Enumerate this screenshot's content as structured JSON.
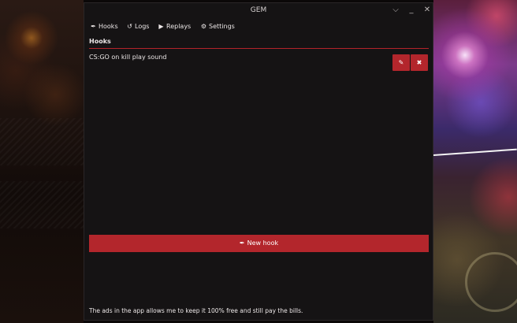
{
  "window": {
    "title": "GEM",
    "controls": {
      "chevron": "⌵",
      "minimize": "_",
      "close": "✕"
    }
  },
  "menu": [
    {
      "label": "Hooks",
      "icon": "plug-icon",
      "glyph": "✒"
    },
    {
      "label": "Logs",
      "icon": "history-icon",
      "glyph": "↺"
    },
    {
      "label": "Replays",
      "icon": "video-icon",
      "glyph": "▶"
    },
    {
      "label": "Settings",
      "icon": "gear-icon",
      "glyph": "⚙"
    }
  ],
  "section": {
    "title": "Hooks"
  },
  "hooks": [
    {
      "name": "CS:GO on kill play sound",
      "edit_glyph": "✎",
      "delete_glyph": "✖"
    }
  ],
  "new_hook": {
    "label": "New hook",
    "glyph": "✒"
  },
  "footer": {
    "text": "The ads in the app allows me to keep it 100% free and still pay the bills."
  },
  "colors": {
    "accent": "#b3262c",
    "window_bg": "#151314",
    "text": "#ece7e7"
  }
}
